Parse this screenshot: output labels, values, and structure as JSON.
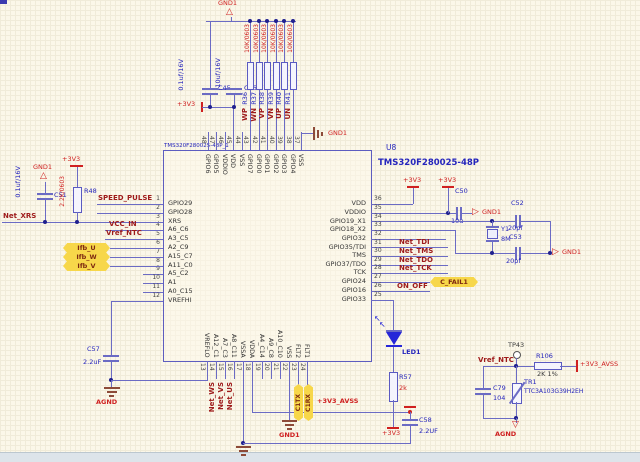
{
  "ic": {
    "ref": "U8",
    "part": "TMS320F280025-48P",
    "sub": "TMS320F280025-48P_1",
    "left": [
      {
        "n": "1",
        "name": "GPIO29"
      },
      {
        "n": "2",
        "name": "GPIO28"
      },
      {
        "n": "3",
        "name": "XRS"
      },
      {
        "n": "4",
        "name": "A6_C6"
      },
      {
        "n": "5",
        "name": "A3_C5"
      },
      {
        "n": "6",
        "name": "A2_C9"
      },
      {
        "n": "7",
        "name": "A15_C7"
      },
      {
        "n": "8",
        "name": "A11_C0"
      },
      {
        "n": "9",
        "name": "A5_C2"
      },
      {
        "n": "10",
        "name": "A1"
      },
      {
        "n": "11",
        "name": "A0_C15"
      },
      {
        "n": "12",
        "name": "VREFHI"
      }
    ],
    "right": [
      {
        "n": "36",
        "name": "VDD"
      },
      {
        "n": "35",
        "name": "VDDIO"
      },
      {
        "n": "34",
        "name": "GPIO19_X1"
      },
      {
        "n": "33",
        "name": "GPIO18_X2"
      },
      {
        "n": "32",
        "name": "GPIO32"
      },
      {
        "n": "31",
        "name": "GPIO35/TDI"
      },
      {
        "n": "30",
        "name": "TMS"
      },
      {
        "n": "29",
        "name": "GPIO37/TDO"
      },
      {
        "n": "28",
        "name": "TCK"
      },
      {
        "n": "27",
        "name": "GPIO24"
      },
      {
        "n": "26",
        "name": "GPIO16"
      },
      {
        "n": "25",
        "name": "GPIO33"
      }
    ],
    "top": [
      {
        "n": "48",
        "name": "GPIO6"
      },
      {
        "n": "47",
        "name": "GPIO5"
      },
      {
        "n": "46",
        "name": "VDDIO"
      },
      {
        "n": "45",
        "name": "VDD"
      },
      {
        "n": "44",
        "name": "VSS"
      },
      {
        "n": "43",
        "name": "GPIO7"
      },
      {
        "n": "42",
        "name": "GPIO0"
      },
      {
        "n": "41",
        "name": "GPIO1"
      },
      {
        "n": "40",
        "name": "GPIO2"
      },
      {
        "n": "39",
        "name": "GPIO3"
      },
      {
        "n": "38",
        "name": "GPIO4"
      },
      {
        "n": "37",
        "name": "VSS"
      }
    ],
    "bottom": [
      {
        "n": "13",
        "name": "VREFLO"
      },
      {
        "n": "14",
        "name": "A12_C1"
      },
      {
        "n": "15",
        "name": "A7_C3"
      },
      {
        "n": "16",
        "name": "A8_C11"
      },
      {
        "n": "17",
        "name": "VSSA"
      },
      {
        "n": "18",
        "name": "VDDA"
      },
      {
        "n": "19",
        "name": "A4_C14"
      },
      {
        "n": "20",
        "name": "A9_C8"
      },
      {
        "n": "21",
        "name": "A10_C10"
      },
      {
        "n": "22",
        "name": "VSS"
      },
      {
        "n": "23",
        "name": "FLT2"
      },
      {
        "n": "24",
        "name": "FLT1"
      }
    ]
  },
  "bank": {
    "value": "10K/0603",
    "refs": [
      "R36",
      "R37",
      "R38",
      "R39",
      "R40",
      "R41"
    ],
    "nets": [
      "WP",
      "WN",
      "VP",
      "VN",
      "UP",
      "UN"
    ]
  },
  "caps": {
    "c45": {
      "ref": "C45",
      "val": "0.1uf/16V"
    },
    "c46": {
      "ref": "C46",
      "val": "10uf/16V"
    },
    "c50": {
      "ref": "C50",
      "val": "10u"
    },
    "c51": {
      "ref": "C51",
      "val": "0.1uf/16V"
    },
    "c52": {
      "ref": "C52",
      "val": "20pf"
    },
    "c53": {
      "ref": "C53",
      "val": "20pf"
    },
    "c57": {
      "ref": "C57",
      "val": "2.2uF"
    },
    "c58": {
      "ref": "C58",
      "val": "2.2UF"
    },
    "c79": {
      "ref": "C79",
      "val": "104"
    }
  },
  "res": {
    "r48": {
      "ref": "R48",
      "val": "2.2K/0603"
    },
    "r57": {
      "ref": "R57",
      "val": "2k"
    },
    "r106": {
      "ref": "R106",
      "val": "2K 1%"
    }
  },
  "xtal": {
    "ref": "Y1",
    "val": "8M"
  },
  "led": {
    "ref": "LED1"
  },
  "tp": {
    "ref": "TP43"
  },
  "tr": {
    "ref": "TR1",
    "val": "TTC3A103G39H2EH"
  },
  "nets": {
    "speed_pulse": "SPEED_PULSE",
    "xrs": "Net_XRS",
    "vcc_in": "VCC_IN",
    "vref_ntc": "Vref_NTC",
    "tdi": "Net_TDI",
    "tms": "Net_TMS",
    "tdo": "Net_TDO",
    "tck": "Net_TCK",
    "on_off": "ON_OFF",
    "ws": "Net_WS",
    "vs": "Net_VS",
    "us": "Net_US",
    "avss": "+3V3_AVSS"
  },
  "power": {
    "v33": "+3V3",
    "gnd": "GND1",
    "agnd": "AGND"
  },
  "tags": {
    "ifb_u": "Ifb_U",
    "ifb_w": "Ifb_W",
    "ifb_v": "Ifb_V",
    "c_fail": "C_FAIL1",
    "c1tx": "C1TX",
    "c1rx": "C1RX"
  }
}
